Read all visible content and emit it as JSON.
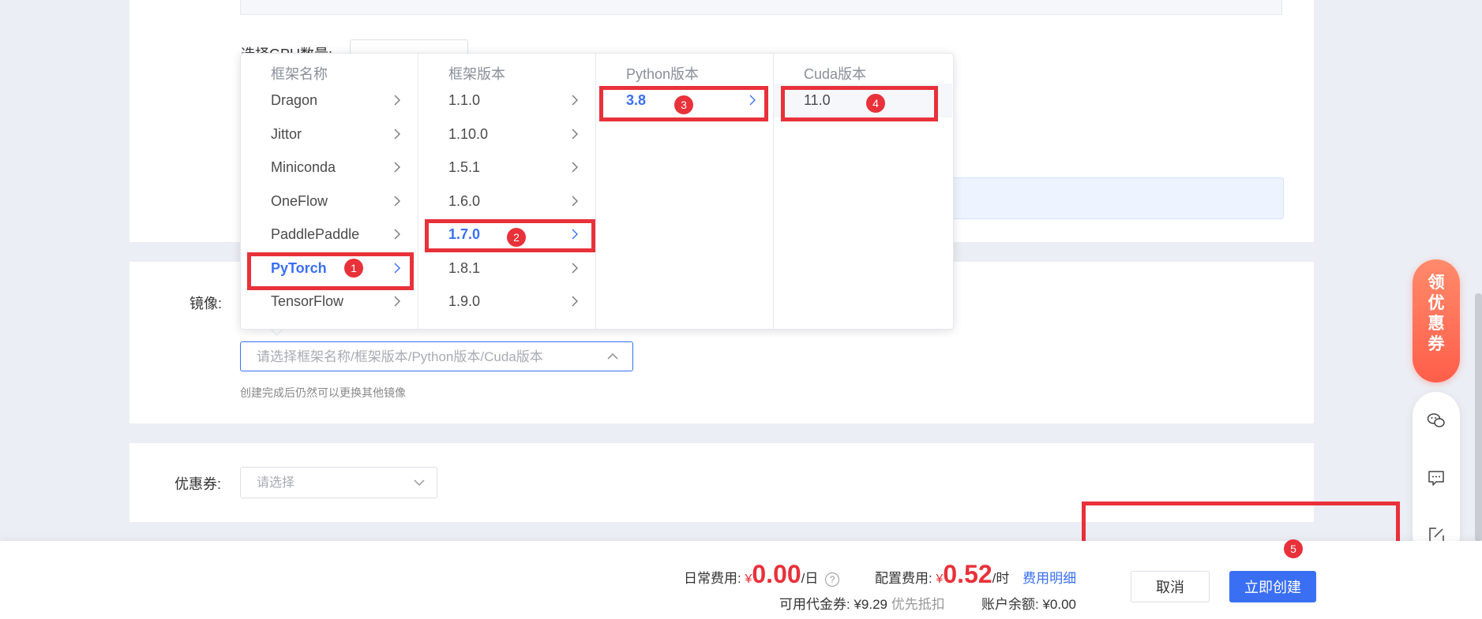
{
  "form": {
    "gpu_label": "选择GPU数量:",
    "mirror_label": "镜像:",
    "mirror_placeholder": "请选择框架名称/框架版本/Python版本/Cuda版本",
    "mirror_hint": "创建完成后仍然可以更换其他镜像",
    "coupon_label": "优惠券:",
    "coupon_placeholder": "请选择"
  },
  "cascader": {
    "columns": [
      {
        "header": "框架名称",
        "items": [
          "Dragon",
          "Jittor",
          "Miniconda",
          "OneFlow",
          "PaddlePaddle",
          "PyTorch",
          "TensorFlow"
        ],
        "active": 5
      },
      {
        "header": "框架版本",
        "items": [
          "1.1.0",
          "1.10.0",
          "1.5.1",
          "1.6.0",
          "1.7.0",
          "1.8.1",
          "1.9.0"
        ],
        "active": 4
      },
      {
        "header": "Python版本",
        "items": [
          "3.8"
        ],
        "active": 0
      },
      {
        "header": "Cuda版本",
        "items": [
          "11.0"
        ],
        "active": null
      }
    ]
  },
  "badges": [
    "1",
    "2",
    "3",
    "4",
    "5"
  ],
  "footer": {
    "daily_label": "日常费用:",
    "yen": "¥",
    "daily_value": "0.00",
    "daily_unit": "/日",
    "config_label": "配置费用:",
    "config_value": "0.52",
    "config_unit": "/时",
    "fee_detail_link": "费用明细",
    "voucher_label": "可用代金券:",
    "voucher_value": "¥9.29",
    "voucher_note": "优先抵扣",
    "balance_label": "账户余额:",
    "balance_value": "¥0.00",
    "cancel_label": "取消",
    "create_label": "立即创建"
  },
  "float": {
    "coupon_chars": [
      "领",
      "优",
      "惠",
      "券"
    ]
  },
  "colors": {
    "accent": "#3a6ff4",
    "price": "#e8313a",
    "annotation": "#e8313a"
  }
}
